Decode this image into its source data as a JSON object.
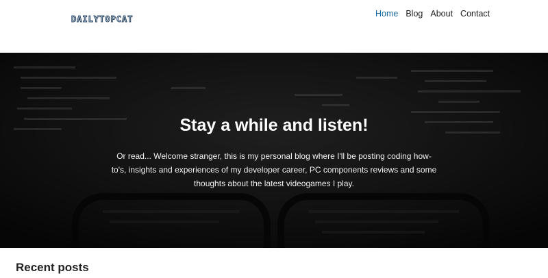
{
  "header": {
    "logo": "DAILYTOPCAT",
    "nav": [
      {
        "label": "Home",
        "active": true
      },
      {
        "label": "Blog",
        "active": false
      },
      {
        "label": "About",
        "active": false
      },
      {
        "label": "Contact",
        "active": false
      }
    ]
  },
  "hero": {
    "title": "Stay a while and listen!",
    "text": "Or read... Welcome stranger, this is my personal blog where I'll be posting coding how-to's, insights and experiences of my developer career, PC components reviews and some thoughts about the latest videogames I play."
  },
  "main": {
    "section_title": "Recent posts"
  },
  "colors": {
    "nav_active": "#1b6aa5",
    "nav_default": "#1d1d1d",
    "hero_background": "#1e1e1e"
  }
}
